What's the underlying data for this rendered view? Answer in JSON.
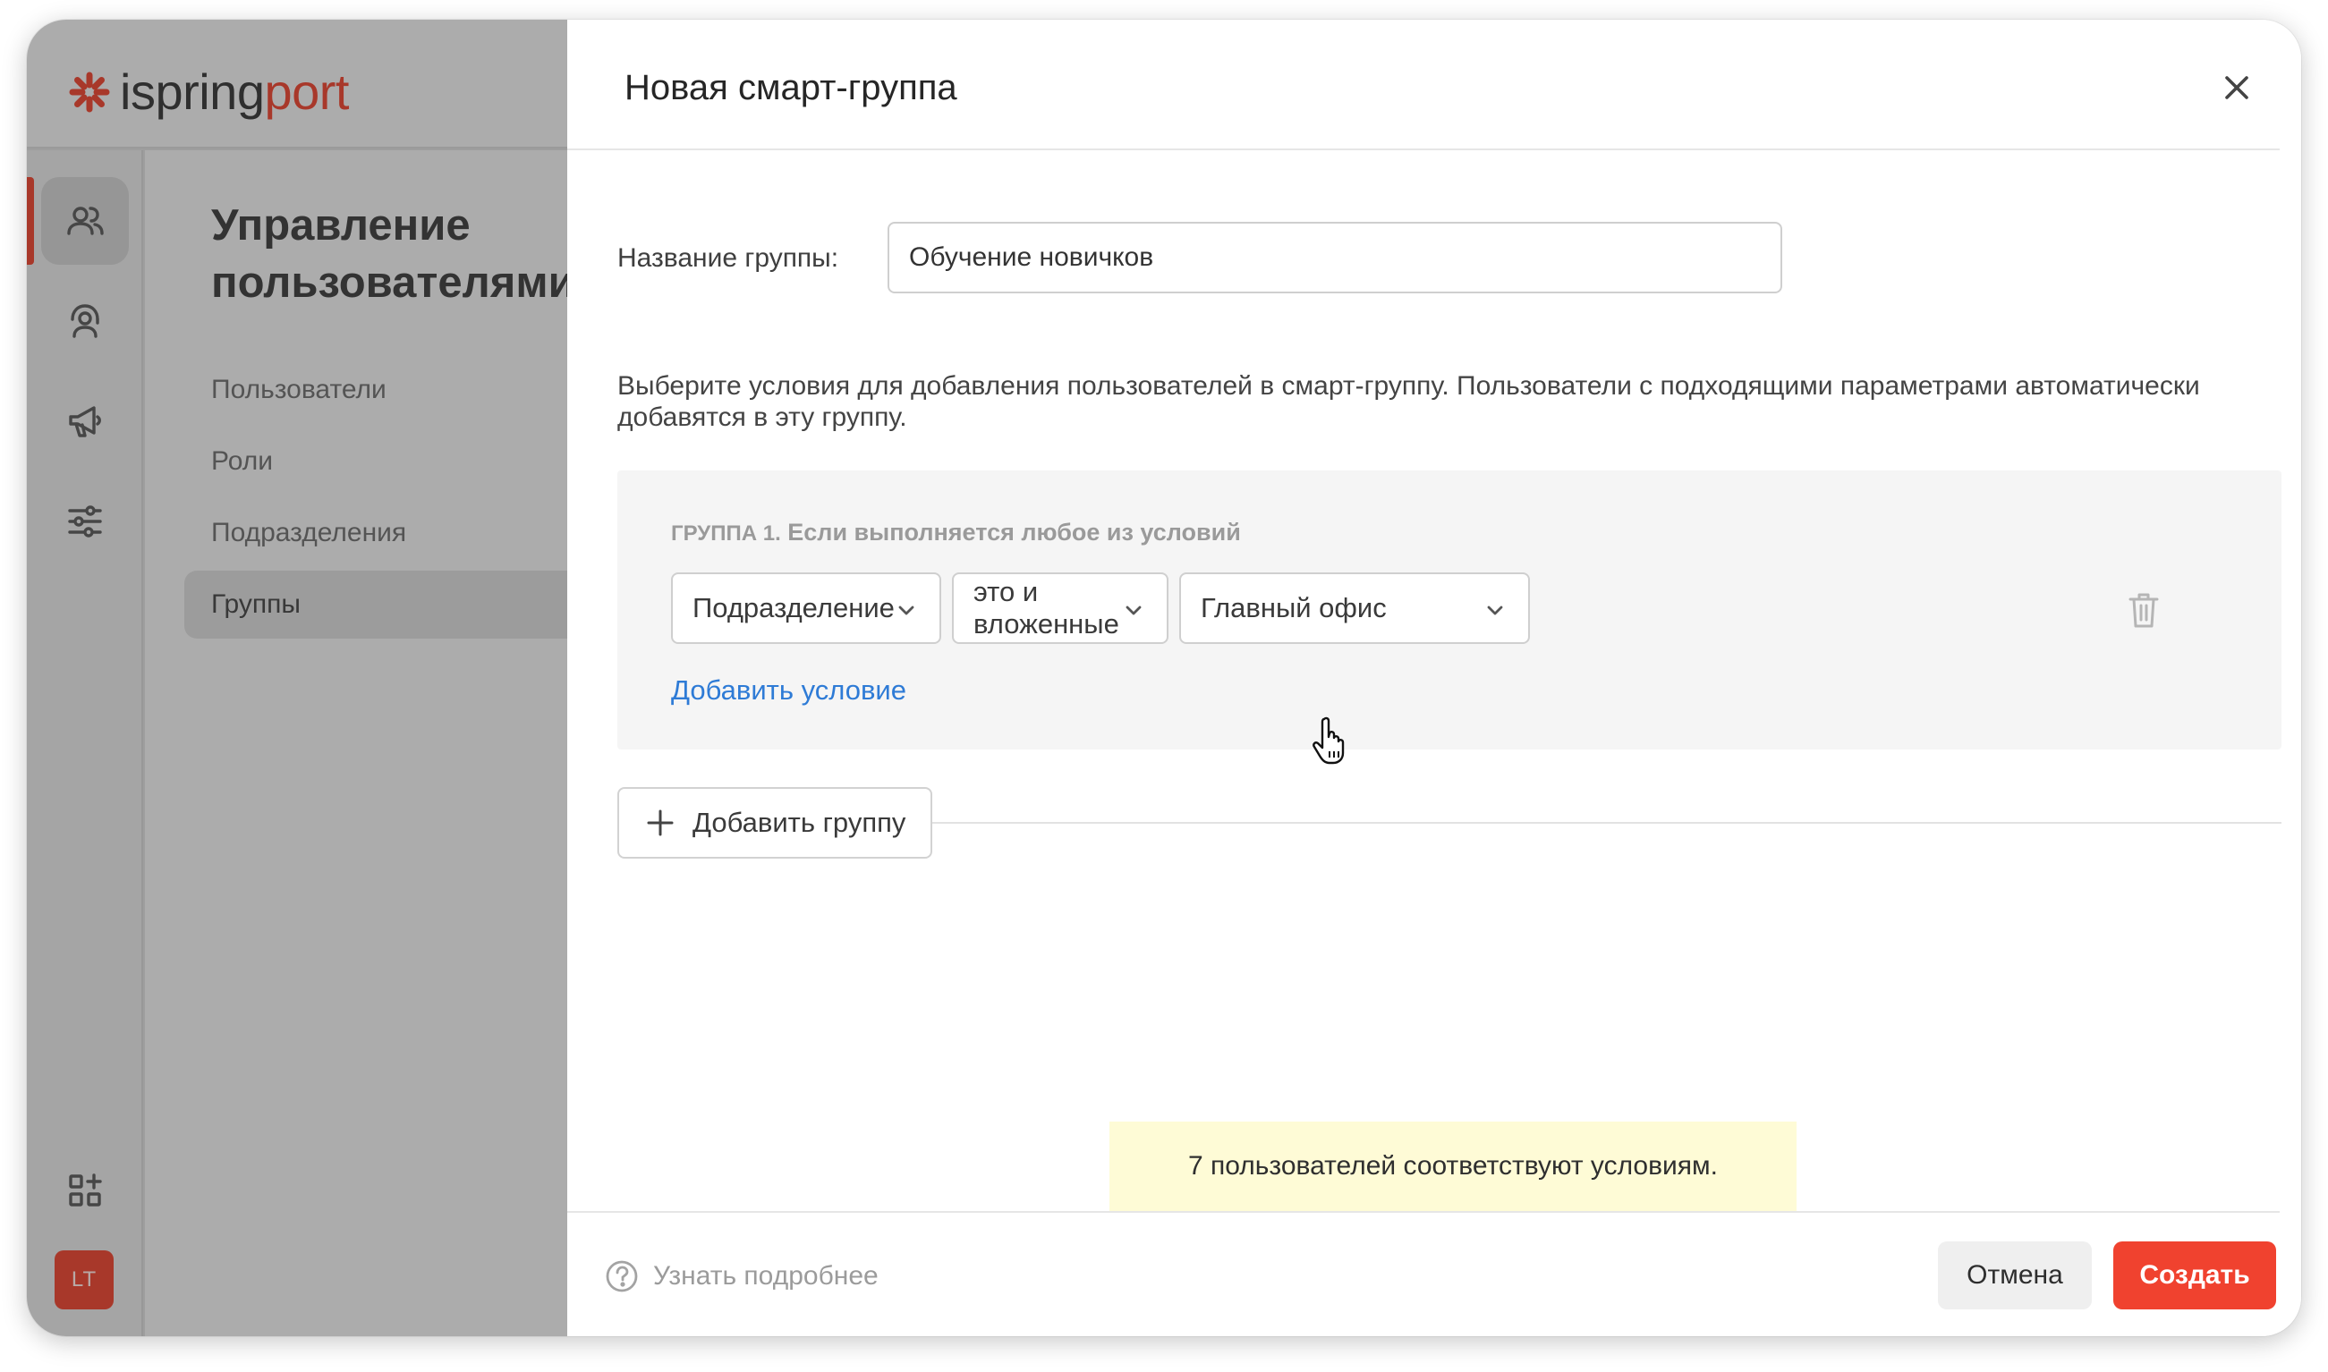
{
  "brand": {
    "name_part1": "ispring",
    "name_part2": "port",
    "accent_color": "#e8412c"
  },
  "rail": {
    "items": [
      {
        "icon": "home-icon",
        "active": false
      },
      {
        "icon": "users-icon",
        "active": true
      },
      {
        "icon": "user-support-icon",
        "active": false
      },
      {
        "icon": "megaphone-icon",
        "active": false
      },
      {
        "icon": "sliders-icon",
        "active": false
      },
      {
        "icon": "apps-add-icon",
        "active": false
      }
    ],
    "avatar_initials": "LT"
  },
  "sidebar": {
    "title": "Управление пользователями",
    "items": [
      {
        "label": "Пользователи",
        "active": false
      },
      {
        "label": "Роли",
        "active": false
      },
      {
        "label": "Подразделения",
        "active": false
      },
      {
        "label": "Группы",
        "active": true
      }
    ]
  },
  "modal": {
    "title": "Новая смарт-группа",
    "name_label": "Название группы:",
    "name_value": "Обучение новичков",
    "description": "Выберите условия для добавления пользователей в смарт-группу. Пользователи с подходящими параметрами автоматически добавятся в эту группу.",
    "group": {
      "heading_prefix": "Группа 1.",
      "heading_rest": "Если выполняется любое из условий",
      "condition": {
        "field": "Подразделение",
        "operator": "это и вложенные",
        "value": "Главный офис"
      },
      "add_condition_label": "Добавить условие"
    },
    "add_group_label": "Добавить группу",
    "match_notice": "7 пользователей соответствуют условиям.",
    "footer": {
      "learn_more": "Узнать подробнее",
      "cancel": "Отмена",
      "create": "Создать"
    }
  }
}
